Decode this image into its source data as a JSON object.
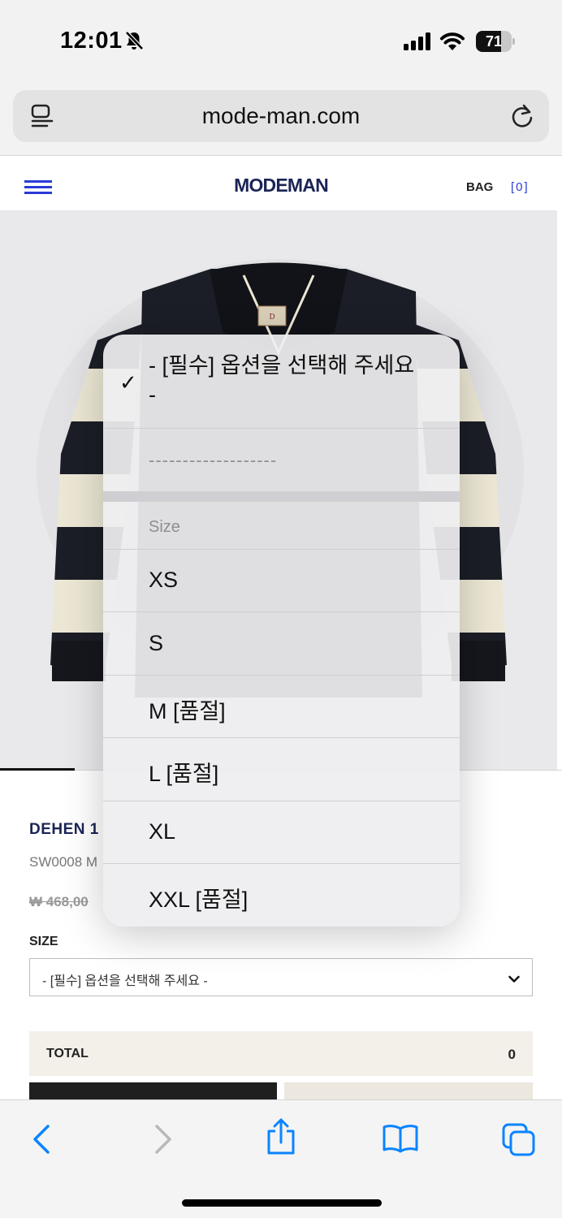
{
  "status_bar": {
    "time": "12:01",
    "battery_level": "71",
    "battery_fraction": 0.71,
    "icons": [
      "bell-slash-icon",
      "cellular-signal-icon",
      "wifi-icon",
      "battery-icon"
    ]
  },
  "browser": {
    "url": "mode-man.com",
    "icons": [
      "reader-mode-icon",
      "reload-icon"
    ]
  },
  "site_header": {
    "logo": "MODEMAN",
    "bag_label": "BAG",
    "bag_count": "[0]",
    "icons": [
      "hamburger-menu-icon"
    ]
  },
  "product": {
    "name": "DEHEN 1",
    "code": "SW0008 M",
    "price": "₩ 468,00",
    "image_colors": [
      "#1b1e26",
      "#ece7d4"
    ]
  },
  "size_field": {
    "label": "SIZE",
    "selected": "- [필수] 옵션을 선택해 주세요 -"
  },
  "total": {
    "label": "TOTAL",
    "value": "0"
  },
  "dropdown": {
    "selected_option": "- [필수] 옵션을 선택해 주세요 -",
    "separator_option": "-------------------",
    "group_label": "Size",
    "options": [
      {
        "label": "XS"
      },
      {
        "label": "S"
      },
      {
        "label": "M [품절]"
      },
      {
        "label": "L [품절]"
      },
      {
        "label": "XL"
      },
      {
        "label": "XXL [품절]"
      }
    ]
  },
  "toolbar": {
    "icons": [
      "back-chevron-icon",
      "forward-chevron-icon",
      "share-icon",
      "bookmarks-book-icon",
      "tabs-icon"
    ]
  },
  "colors": {
    "brand_navy": "#1b2456",
    "accent_blue": "#2a3bd6",
    "ios_blue": "#0a84ff"
  }
}
